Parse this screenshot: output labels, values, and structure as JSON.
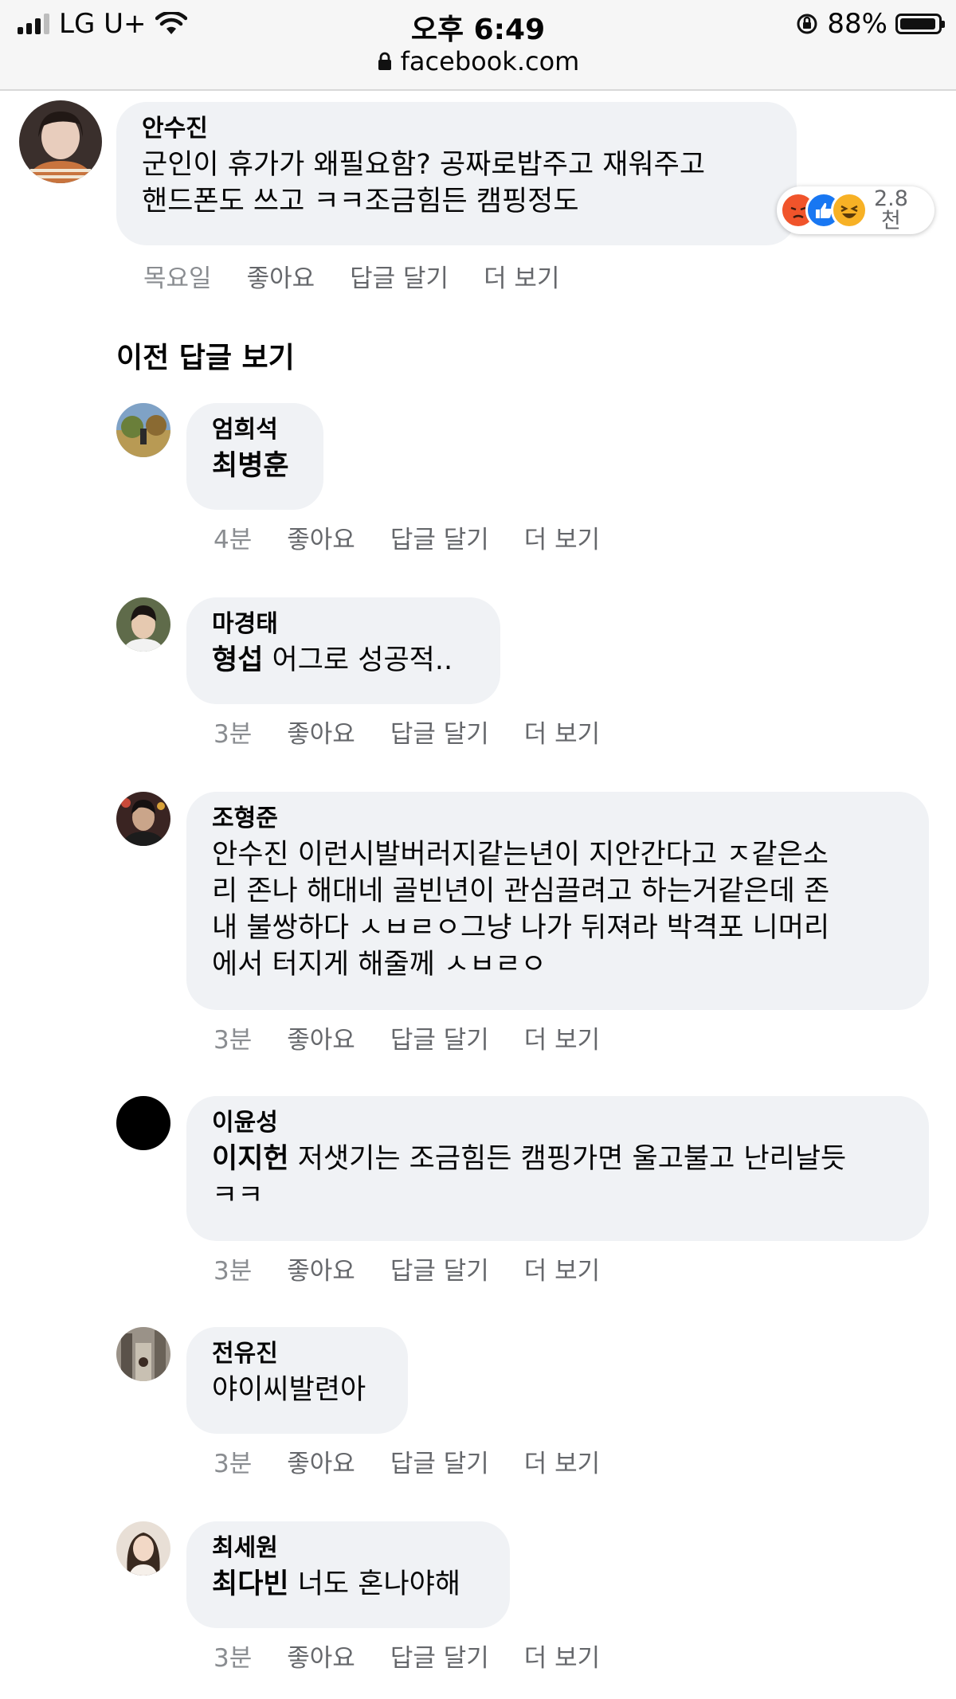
{
  "status_bar": {
    "carrier": "LG U+",
    "time": "오후 6:49",
    "battery_percent": "88%",
    "battery_level": 0.88,
    "url": "facebook.com"
  },
  "main_comment": {
    "author": "안수진",
    "lines": [
      "군인이 휴가가 왜필요함? 공짜로밥주고 재워주고",
      "핸드폰도 쓰고 ㅋㅋ조금힘든 캠핑정도"
    ],
    "reactions": {
      "icons": [
        "angry-icon",
        "like-icon",
        "haha-icon"
      ],
      "count_line1": "2.8",
      "count_line2": "천"
    },
    "actions": {
      "time": "목요일",
      "like": "좋아요",
      "reply": "답글 달기",
      "more": "더 보기"
    }
  },
  "previous_replies_label": "이전 답글 보기",
  "replies": [
    {
      "author": "엄희석",
      "lines": [
        {
          "tag": "최병훈",
          "text": ""
        }
      ],
      "actions": {
        "time": "4분",
        "like": "좋아요",
        "reply": "답글 달기",
        "more": "더 보기"
      }
    },
    {
      "author": "마경태",
      "lines": [
        {
          "tag": "형섭",
          "text": " 어그로 성공적.."
        }
      ],
      "actions": {
        "time": "3분",
        "like": "좋아요",
        "reply": "답글 달기",
        "more": "더 보기"
      }
    },
    {
      "author": "조형준",
      "lines": [
        {
          "tag": "",
          "text": "안수진 이런시발버러지같는년이 지안간다고 ㅈ같은소"
        },
        {
          "tag": "",
          "text": "리 존나 해대네 골빈년이 관심끌려고 하는거같은데 존"
        },
        {
          "tag": "",
          "text": "내 불쌍하다 ㅅㅂㄹㅇ그냥 나가 뒤져라 박격포 니머리"
        },
        {
          "tag": "",
          "text": "에서 터지게 해줄께 ㅅㅂㄹㅇ"
        }
      ],
      "actions": {
        "time": "3분",
        "like": "좋아요",
        "reply": "답글 달기",
        "more": "더 보기"
      }
    },
    {
      "author": "이윤성",
      "lines": [
        {
          "tag": "이지헌",
          "text": " 저샛기는 조금힘든 캠핑가면 울고불고 난리날듯"
        },
        {
          "tag": "",
          "text": "ㅋㅋ"
        }
      ],
      "actions": {
        "time": "3분",
        "like": "좋아요",
        "reply": "답글 달기",
        "more": "더 보기"
      }
    },
    {
      "author": "전유진",
      "lines": [
        {
          "tag": "",
          "text": "야이씨발련아"
        }
      ],
      "actions": {
        "time": "3분",
        "like": "좋아요",
        "reply": "답글 달기",
        "more": "더 보기"
      }
    },
    {
      "author": "최세원",
      "lines": [
        {
          "tag": "최다빈",
          "text": " 너도 혼나야해"
        }
      ],
      "actions": {
        "time": "3분",
        "like": "좋아요",
        "reply": "답글 달기",
        "more": "더 보기"
      }
    }
  ],
  "colors": {
    "bubble": "#f0f2f5",
    "meta_text": "#65676b",
    "like_blue": "#1877f2",
    "angry": "#f0542b",
    "haha": "#f7b125"
  }
}
